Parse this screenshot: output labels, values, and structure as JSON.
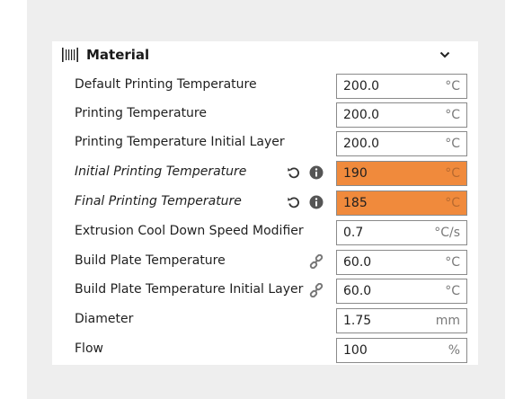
{
  "section": {
    "title": "Material",
    "icon": "material-spools-icon",
    "collapse_icon": "chevron-down-icon"
  },
  "settings": [
    {
      "label": "Default Printing Temperature",
      "value": "200.0",
      "unit": "°C",
      "italic": false,
      "highlight": false
    },
    {
      "label": "Printing Temperature",
      "value": "200.0",
      "unit": "°C",
      "italic": false,
      "highlight": false
    },
    {
      "label": "Printing Temperature Initial Layer",
      "value": "200.0",
      "unit": "°C",
      "italic": false,
      "highlight": false
    },
    {
      "label": "Initial Printing Temperature",
      "value": "190",
      "unit": "°C",
      "italic": true,
      "highlight": true,
      "icons": [
        "reset-icon",
        "info-icon"
      ]
    },
    {
      "label": "Final Printing Temperature",
      "value": "185",
      "unit": "°C",
      "italic": true,
      "highlight": true,
      "icons": [
        "reset-icon",
        "info-icon"
      ]
    },
    {
      "label": "Extrusion Cool Down Speed Modifier",
      "value": "0.7",
      "unit": "°C/s",
      "italic": false,
      "highlight": false
    },
    {
      "label": "Build Plate Temperature",
      "value": "60.0",
      "unit": "°C",
      "italic": false,
      "highlight": false,
      "icons": [
        "link-icon"
      ]
    },
    {
      "label": "Build Plate Temperature Initial Layer",
      "value": "60.0",
      "unit": "°C",
      "italic": false,
      "highlight": false,
      "icons": [
        "link-icon"
      ]
    },
    {
      "label": "Diameter",
      "value": "1.75",
      "unit": "mm",
      "italic": false,
      "highlight": false
    },
    {
      "label": "Flow",
      "value": "100",
      "unit": "%",
      "italic": false,
      "highlight": false
    }
  ],
  "colors": {
    "highlight": "#f08a3c",
    "backdrop": "#eeeeee"
  }
}
